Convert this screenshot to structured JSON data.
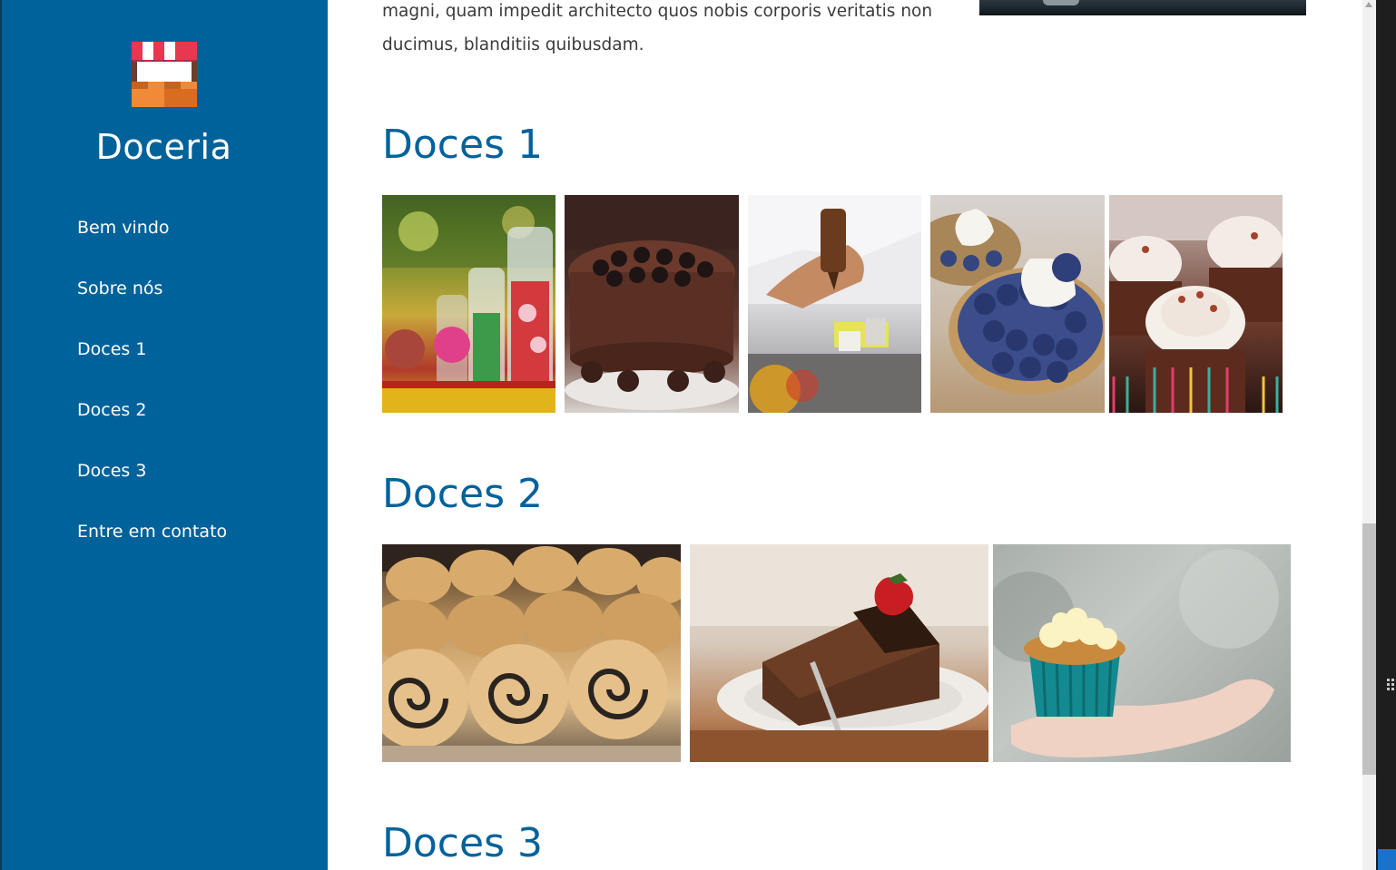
{
  "sidebar": {
    "brand": "Doceria",
    "logo_icon": "market-stall-icon",
    "items": [
      {
        "label": "Bem vindo"
      },
      {
        "label": "Sobre nós"
      },
      {
        "label": "Doces 1"
      },
      {
        "label": "Doces 2"
      },
      {
        "label": "Doces 3"
      },
      {
        "label": "Entre em contato"
      }
    ]
  },
  "intro": {
    "text": "magni, quam impedit architecto quos nobis corporis veritatis non ducimus, blanditiis quibusdam."
  },
  "sections": [
    {
      "title": "Doces 1",
      "photos": [
        "candy-jars-photo",
        "chocolate-cake-photo",
        "chef-decorating-photo",
        "blueberry-tarts-photo",
        "cupcakes-photo"
      ]
    },
    {
      "title": "Doces 2",
      "photos": [
        "poppy-seed-rolls-photo",
        "chocolate-cake-slice-photo",
        "cupcake-in-hand-photo"
      ]
    },
    {
      "title": "Doces 3",
      "photos": []
    }
  ],
  "colors": {
    "sidebar_bg": "#00629a",
    "heading": "#00629a",
    "body_text": "#3a3a3a"
  }
}
